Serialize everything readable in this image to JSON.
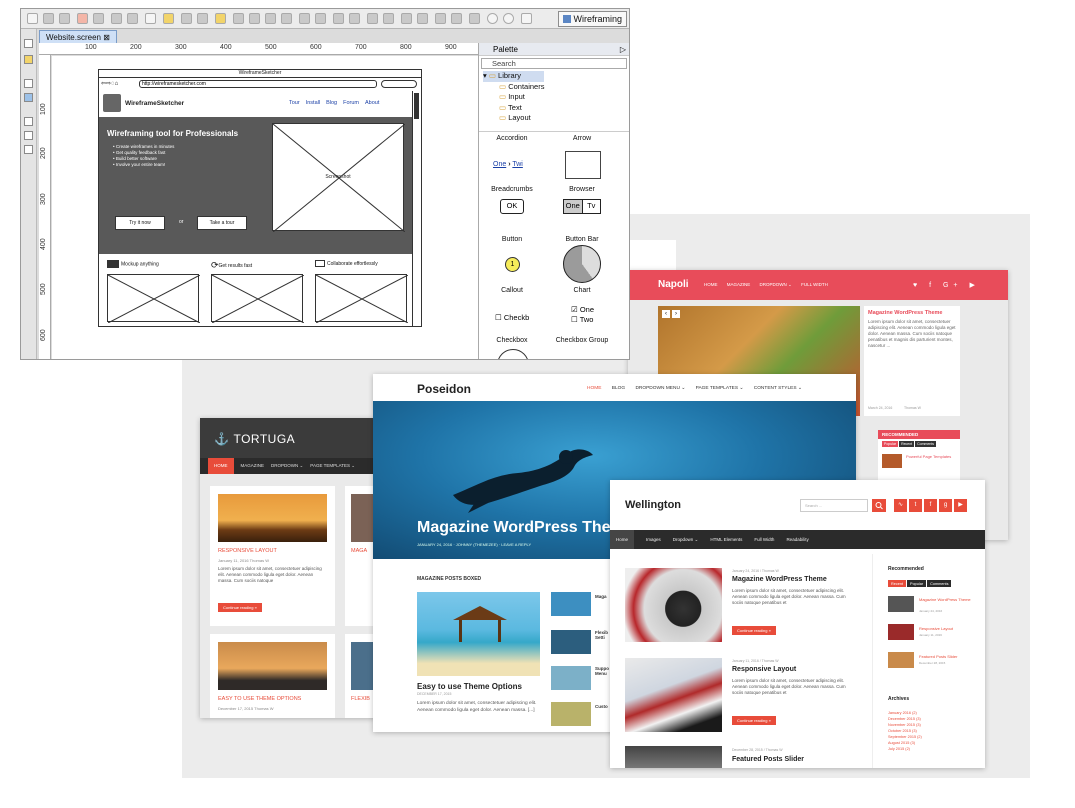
{
  "editor": {
    "app_button": "Wireframing",
    "tab_label": "Website.screen",
    "ruler_h": [
      "100",
      "200",
      "300",
      "400",
      "500",
      "600",
      "700",
      "800",
      "900"
    ],
    "ruler_v": [
      "100",
      "200",
      "300",
      "400",
      "500",
      "600"
    ],
    "mock": {
      "window_title": "WireframeSketcher",
      "url": "http://wireframesketcher.com",
      "brand": "WireframeSketcher",
      "menu": [
        "Tour",
        "Install",
        "Blog",
        "Forum",
        "About"
      ],
      "hero_title": "Wireframing tool for Professionals",
      "bullets": [
        "Create wireframes in minutes",
        "Get quality feedback fast",
        "Build better software",
        "Involve your entire team!"
      ],
      "screenshot_label": "Screenshot",
      "btn_try": "Try it now",
      "or": "or",
      "btn_tour": "Take a tour",
      "features": [
        "Mockup anything",
        "Get results fast",
        "Collaborate effortlessly"
      ]
    },
    "palette": {
      "title": "Palette",
      "search": "Search",
      "tree": [
        "Library",
        "Containers",
        "Input",
        "Text",
        "Layout"
      ],
      "items": [
        "Accordion",
        "Arrow",
        "Breadcrumbs",
        "Browser",
        "Button",
        "Button Bar",
        "Callout",
        "Chart",
        "Checkbox",
        "Checkbox Group"
      ],
      "breadcrumb_a": "One",
      "breadcrumb_b": "Twi",
      "ok": "OK",
      "bbar_a": "One",
      "bbar_b": "Tv",
      "callout_num": "1",
      "checkbox": "Checkb",
      "group_a": "One",
      "group_b": "Two"
    }
  },
  "napoli": {
    "brand": "Napoli",
    "menu": [
      "HOME",
      "MAGAZINE",
      "DROPDOWN ⌄",
      "FULL WIDTH"
    ],
    "social": "♥ f G+ ▶",
    "side_title": "Magazine WordPress Theme",
    "side_text": "Lorem ipsum dolor sit amet, consectetuer adipiscing elit. Aenean commodo ligula eget dolor. Aenean massa. Cum sociis natoque penatibus et magnis dis parturient montes, nascetur ...",
    "date": "March 24, 2016",
    "author": "Thomas W",
    "rec_title": "RECOMMENDED",
    "rec_tabs": [
      "Popular",
      "Recent",
      "Comments"
    ],
    "rec_item": "Powerful Page Templates"
  },
  "tortuga": {
    "brand": "TORTUGA",
    "nav": [
      "HOME",
      "MAGAZINE",
      "DROPDOWN ⌄",
      "PAGE TEMPLATES ⌄"
    ],
    "post1_title": "RESPONSIVE LAYOUT",
    "post1_meta": "January 11, 2016    Thomas W",
    "post_text": "Lorem ipsum dolor sit amet, consectetuer adipiscing elit. Aenean commodo ligula eget dolor. Aenean massa. Cum sociis natoque",
    "btn": "Continue reading »",
    "post2_title": "EASY TO USE THEME OPTIONS",
    "post2_meta": "December 17, 2015    Thomas W",
    "peek1": "MAGA",
    "peek2": "FLEXIB"
  },
  "poseidon": {
    "brand": "Poseidon",
    "menu": [
      "HOME",
      "BLOG",
      "DROPDOWN MENU ⌄",
      "PAGE TEMPLATES ⌄",
      "CONTENT STYLES ⌄"
    ],
    "hero_title": "Magazine WordPress Theme",
    "hero_meta": "JANUARY 24, 2016 · JOHNNY (THEMEZEE) · LEAVE A REPLY",
    "section": "MAGAZINE POSTS BOXED",
    "post_title": "Easy to use Theme Options",
    "post_meta": "DECEMBER 17, 2015",
    "post_text": "Lorem ipsum dolor sit amet, consectetuer adipiscing elit. Aenean commodo ligula eget dolor. Aenean massa. [...]",
    "side": [
      "Maga",
      "Flexib Setti",
      "Suppo Menu",
      "Custo"
    ]
  },
  "wellington": {
    "brand": "Wellington",
    "search": "Search ...",
    "nav": [
      "Home",
      "Images",
      "Dropdown ⌄",
      "HTML Elements",
      "Full Width",
      "Readability"
    ],
    "post1_meta": "January 24, 2016  /  Thomas W",
    "post1_title": "Magazine WordPress Theme",
    "post_text": "Lorem ipsum dolor sit amet, consectetuer adipiscing elit. Aenean commodo ligula eget dolor. Aenean massa. Cum sociis natoque penatibus et",
    "btn": "Continue reading »",
    "post2_meta": "January 11, 2016  /  Thomas W",
    "post2_title": "Responsive Layout",
    "post3_meta": "December 28, 2015  /  Thomas W",
    "post3_title": "Featured Posts Slider",
    "side_rec": "Recommended",
    "side_tabs": [
      "Recent",
      "Popular",
      "Comments"
    ],
    "side_items": [
      "Magazine WordPress Theme",
      "Responsive Layout",
      "Featured Posts Slider"
    ],
    "side_dates": [
      "January 24, 2016",
      "January 11, 2016",
      "December 28, 2015"
    ],
    "archives": "Archives",
    "archive_list": [
      "January 2016 (2)",
      "December 2015 (3)",
      "November 2015 (3)",
      "October 2015 (3)",
      "September 2015 (2)",
      "August 2015 (3)",
      "July 2015 (2)"
    ]
  }
}
